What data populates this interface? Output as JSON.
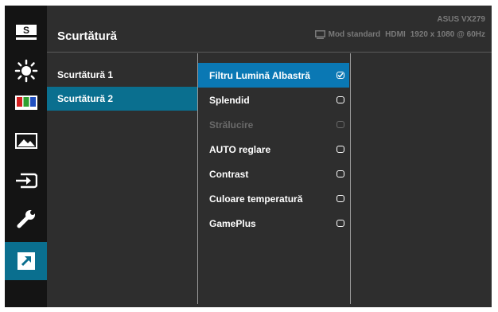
{
  "header": {
    "title": "Scurtătură",
    "model": "ASUS VX279",
    "mode": "Mod standard",
    "input": "HDMI",
    "resolution": "1920 x 1080 @ 60Hz"
  },
  "iconbar": [
    {
      "name": "splendid-s-icon",
      "active": false
    },
    {
      "name": "brightness-icon",
      "active": false
    },
    {
      "name": "color-icon",
      "active": false
    },
    {
      "name": "image-icon",
      "active": false
    },
    {
      "name": "input-select-icon",
      "active": false
    },
    {
      "name": "system-setup-wrench-icon",
      "active": false
    },
    {
      "name": "shortcut-icon",
      "active": true
    }
  ],
  "shortcut_list": [
    {
      "label": "Scurtătură 1",
      "selected": false
    },
    {
      "label": "Scurtătură 2",
      "selected": true
    }
  ],
  "options": [
    {
      "label": "Filtru Lumină Albastră",
      "checked": true,
      "enabled": true,
      "highlighted": true
    },
    {
      "label": "Splendid",
      "checked": false,
      "enabled": true,
      "highlighted": false
    },
    {
      "label": "Strălucire",
      "checked": false,
      "enabled": false,
      "highlighted": false
    },
    {
      "label": "AUTO reglare",
      "checked": false,
      "enabled": true,
      "highlighted": false
    },
    {
      "label": "Contrast",
      "checked": false,
      "enabled": true,
      "highlighted": false
    },
    {
      "label": "Culoare temperatură",
      "checked": false,
      "enabled": true,
      "highlighted": false
    },
    {
      "label": "GamePlus",
      "checked": false,
      "enabled": true,
      "highlighted": false
    }
  ],
  "colors": {
    "accent": "#0a78b4",
    "selected_row": "#0a6f8f",
    "panel": "#2e2e2e",
    "iconbar": "#141414"
  }
}
